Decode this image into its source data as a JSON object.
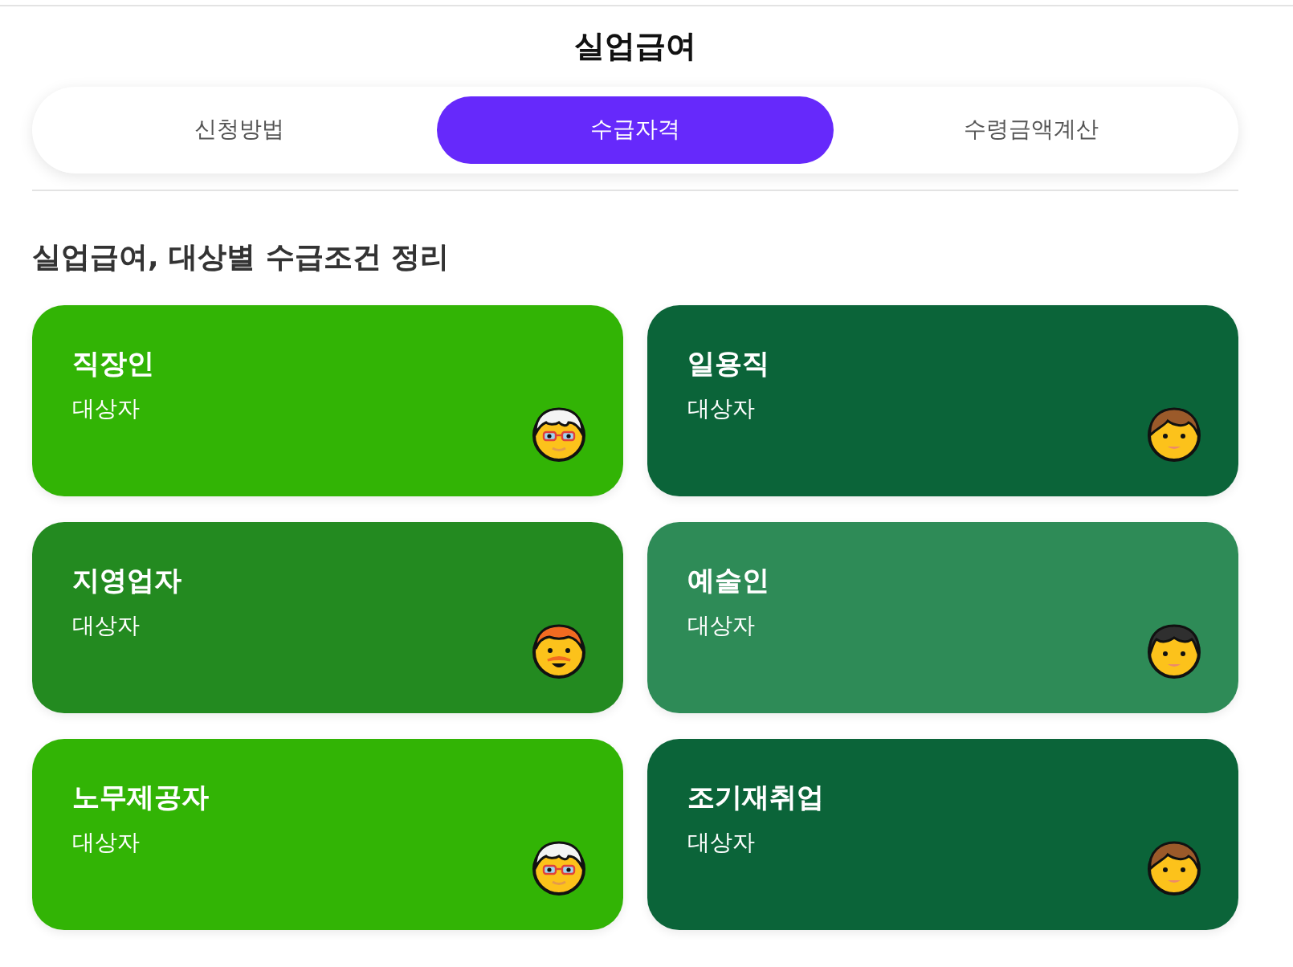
{
  "header": {
    "title": "실업급여"
  },
  "tabs": [
    {
      "label": "신청방법",
      "selected": false
    },
    {
      "label": "수급자격",
      "selected": true
    },
    {
      "label": "수령금액계산",
      "selected": false
    }
  ],
  "section": {
    "heading": "실업급여, 대상별 수급조건 정리",
    "cards": [
      {
        "title": "직장인",
        "subtitle": "대상자",
        "color": "#32b405"
      },
      {
        "title": "일용직",
        "subtitle": "대상자",
        "color": "#0b6439"
      },
      {
        "title": "지영업자",
        "subtitle": "대상자",
        "color": "#238a20"
      },
      {
        "title": "예술인",
        "subtitle": "대상자",
        "color": "#2e8b57"
      },
      {
        "title": "노무제공자",
        "subtitle": "대상자",
        "color": "#32b405"
      },
      {
        "title": "조기재취업",
        "subtitle": "대상자",
        "color": "#0b6439"
      }
    ]
  }
}
